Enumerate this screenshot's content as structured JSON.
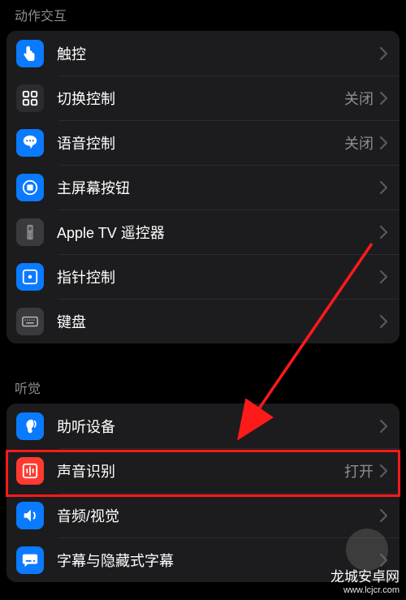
{
  "sections": {
    "interaction": {
      "title": "动作交互"
    },
    "hearing": {
      "title": "听觉"
    }
  },
  "rows": {
    "touch": {
      "label": "触控",
      "value": ""
    },
    "switch": {
      "label": "切换控制",
      "value": "关闭"
    },
    "voice": {
      "label": "语音控制",
      "value": "关闭"
    },
    "home": {
      "label": "主屏幕按钮",
      "value": ""
    },
    "appletv": {
      "label": "Apple TV 遥控器",
      "value": ""
    },
    "pointer": {
      "label": "指针控制",
      "value": ""
    },
    "keyboard": {
      "label": "键盘",
      "value": ""
    },
    "hearing_dev": {
      "label": "助听设备",
      "value": ""
    },
    "sound_recog": {
      "label": "声音识别",
      "value": "打开"
    },
    "audio_visual": {
      "label": "音频/视觉",
      "value": ""
    },
    "subtitles": {
      "label": "字幕与隐藏式字幕",
      "value": ""
    }
  },
  "watermark": {
    "line1": "龙城安卓网",
    "line2": "www.lcjcr.com"
  },
  "colors": {
    "highlight": "#ff1a1a"
  }
}
